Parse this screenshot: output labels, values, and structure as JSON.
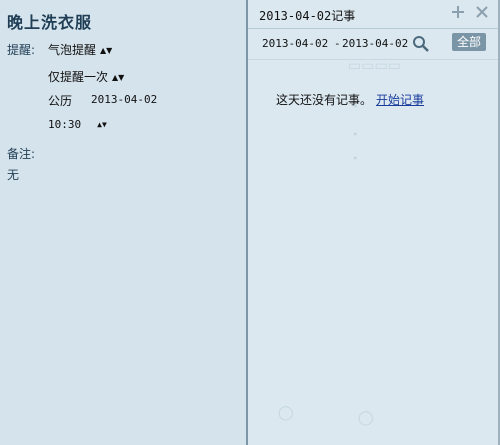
{
  "reminder": {
    "title": "晚上洗衣服",
    "remind_label": "提醒:",
    "remind_type": "气泡提醒",
    "repeat": "仅提醒一次",
    "calendar": "公历",
    "date": "2013-04-02",
    "time": "10:30",
    "note_label": "备注:",
    "note_value": "无"
  },
  "journal": {
    "title": "2013-04-02记事",
    "date_from": "2013-04-02",
    "date_sep": "-",
    "date_to": "2013-04-02",
    "all_label": "全部",
    "empty_text": "这天还没有记事。",
    "start_link": "开始记事"
  },
  "icons": {
    "add": "plus-icon",
    "close": "close-icon",
    "search": "search-icon",
    "dropdown": "updown-arrow-icon"
  },
  "colors": {
    "left_bg": "#d5e3ec",
    "right_bg": "#dbe8f0",
    "title_color": "#1f3e55",
    "all_button": "#7a95a6",
    "link": "#1a3d9c"
  }
}
